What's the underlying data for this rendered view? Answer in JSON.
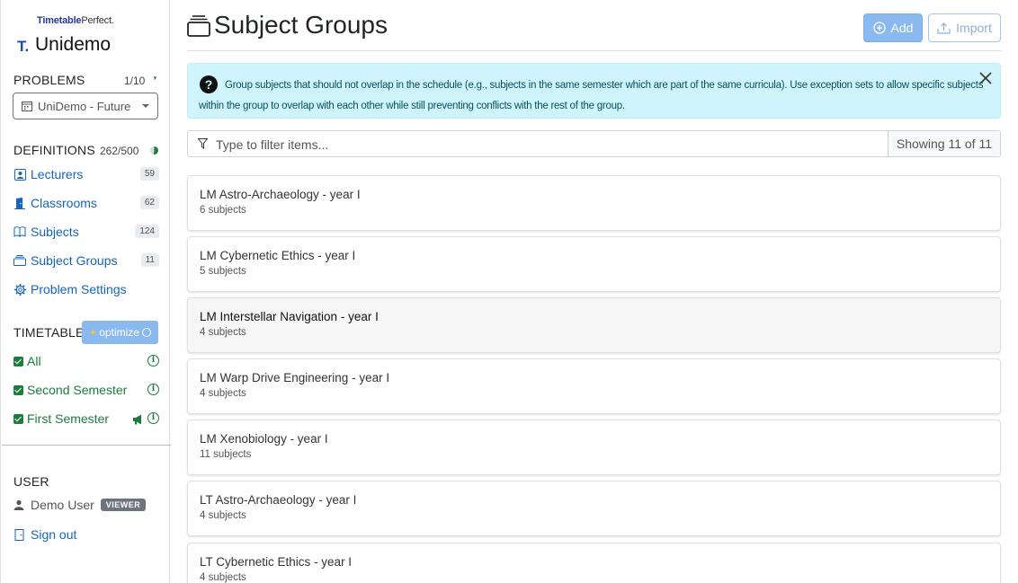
{
  "sidebar": {
    "brand_small_bold": "Timetable",
    "brand_small_light": "Perfect.",
    "brand_logo": "T.",
    "brand_name": "Unidemo",
    "problems": {
      "label": "PROBLEMS",
      "count": "1/10",
      "select_value": "UniDemo - Future"
    },
    "definitions": {
      "label": "DEFINITIONS",
      "count": "262/500",
      "items": [
        {
          "label": "Lecturers",
          "badge": "59",
          "icon": "user-icon"
        },
        {
          "label": "Classrooms",
          "badge": "62",
          "icon": "door-icon"
        },
        {
          "label": "Subjects",
          "badge": "124",
          "icon": "book-icon"
        },
        {
          "label": "Subject Groups",
          "badge": "11",
          "icon": "folder-stack-icon"
        },
        {
          "label": "Problem Settings",
          "badge": "",
          "icon": "gear-icon"
        }
      ]
    },
    "timetables": {
      "label": "TIMETABLES",
      "optimize_label": "optimize",
      "items": [
        {
          "label": "All"
        },
        {
          "label": "Second Semester"
        },
        {
          "label": "First Semester"
        }
      ]
    },
    "user": {
      "label": "USER",
      "name": "Demo User",
      "role": "VIEWER",
      "signout": "Sign out"
    }
  },
  "main": {
    "title": "Subject Groups",
    "add_label": "Add",
    "import_label": "Import",
    "alert_text": "Group subjects that should not overlap in the schedule (e.g., subjects in the same semester which are part of the same curricula). Use exception sets to allow specific subjects within the group to overlap with each other while still preventing conflicts with the rest of the group.",
    "filter_placeholder": "Type to filter items...",
    "filter_count": "Showing 11 of 11",
    "groups": [
      {
        "name": "LM Astro-Archaeology - year I",
        "count": "6 subjects"
      },
      {
        "name": "LM Cybernetic Ethics - year I",
        "count": "5 subjects"
      },
      {
        "name": "LM Interstellar Navigation - year I",
        "count": "4 subjects"
      },
      {
        "name": "LM Warp Drive Engineering - year I",
        "count": "4 subjects"
      },
      {
        "name": "LM Xenobiology - year I",
        "count": "11 subjects"
      },
      {
        "name": "LT Astro-Archaeology - year I",
        "count": "4 subjects"
      },
      {
        "name": "LT Cybernetic Ethics - year I",
        "count": "4 subjects"
      }
    ]
  },
  "colors": {
    "link": "#1565c0",
    "timetable": "#1a7d3b",
    "accent_button": "#8ab9ef",
    "alert_bg": "#cff4fc"
  }
}
